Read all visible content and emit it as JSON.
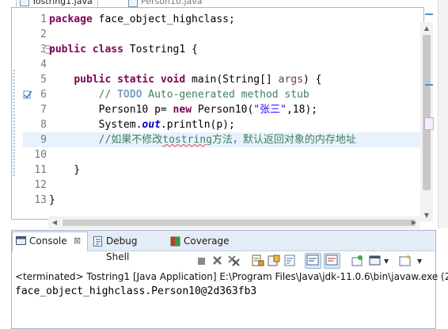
{
  "editor": {
    "tabs": [
      {
        "label": "Tostring1.java",
        "active": true
      },
      {
        "label": "Person10.java",
        "active": false
      }
    ],
    "lines": [
      {
        "n": "1",
        "code": "package face_object_highclass;"
      },
      {
        "n": "2",
        "code": ""
      },
      {
        "n": "3",
        "code": "public class Tostring1 {"
      },
      {
        "n": "4",
        "code": ""
      },
      {
        "n": "5",
        "code": "    public static void main(String[] args) {"
      },
      {
        "n": "6",
        "code": "        // TODO Auto-generated method stub"
      },
      {
        "n": "7",
        "code": "        Person10 p= new Person10(\"张三\",18);"
      },
      {
        "n": "8",
        "code": "        System.out.println(p);"
      },
      {
        "n": "9",
        "code": "        //如果不修改tostring方法，默认返回对象的内存地址"
      },
      {
        "n": "10",
        "code": ""
      },
      {
        "n": "11",
        "code": "    }"
      },
      {
        "n": "12",
        "code": ""
      },
      {
        "n": "13",
        "code": "}"
      }
    ],
    "tokens": {
      "l1_kw": "package",
      "l1_rest": " face_object_highclass;",
      "l3_kw1": "public",
      "l3_kw2": "class",
      "l3_rest": " Tostring1 {",
      "l5_indent": "    ",
      "l5_kw1": "public",
      "l5_kw2": "static",
      "l5_kw3": "void",
      "l5_mid": " main(String[] ",
      "l5_param": "args",
      "l5_end": ") {",
      "l6_indent": "        ",
      "l6_open": "// ",
      "l6_todo": "TODO",
      "l6_rest": " Auto-generated method stub",
      "l7_indent": "        ",
      "l7_a": "Person10 p= ",
      "l7_kw": "new",
      "l7_b": " Person10(",
      "l7_str": "\"张三\"",
      "l7_c": ",18);",
      "l8_indent": "        ",
      "l8_a": "System.",
      "l8_field": "out",
      "l8_b": ".println(p);",
      "l9_indent": "        ",
      "l9_a": "//如果不修改",
      "l9_spell": "tostring",
      "l9_b": "方法，默认返回对象的内存地址",
      "l11_code": "    }",
      "l13_code": "}"
    }
  },
  "console": {
    "tabs": [
      {
        "label": "Console",
        "icon": "console-icon",
        "active": true,
        "close": "⊠"
      },
      {
        "label": "Debug Shell",
        "icon": "debug-shell-icon",
        "active": false
      },
      {
        "label": "Coverage",
        "icon": "coverage-icon",
        "active": false
      }
    ],
    "toolbar": [
      "terminate",
      "remove-launch",
      "remove-all-terminated",
      "scroll-lock",
      "clear-console",
      "show-console-on-output",
      "pin-console",
      "display-selected-console",
      "open-console",
      "new-console"
    ],
    "status": "<terminated> Tostring1 [Java Application] E:\\Program Files\\Java\\jdk-11.0.6\\bin\\javaw.exe (2",
    "output": "face_object_highclass.Person10@2d363fb3"
  },
  "colors": {
    "keyword": "#7f0055",
    "comment": "#3f7f5f",
    "todo": "#7f9fbf",
    "string": "#2a00ff",
    "field": "#0000c0",
    "current_line": "#e8f2fe",
    "panel_tab_bg": "#e4ecf5"
  }
}
